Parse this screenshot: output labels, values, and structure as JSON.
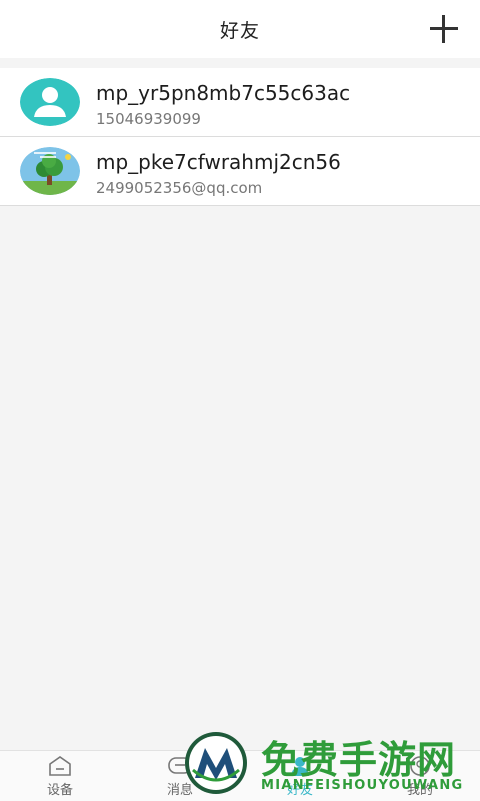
{
  "header": {
    "title": "好友",
    "add_icon": "plus-icon"
  },
  "friends": [
    {
      "name": "mp_yr5pn8mb7c55c63ac",
      "subtitle": "15046939099",
      "avatar": "default-user-avatar"
    },
    {
      "name": "mp_pke7cfwrahmj2cn56",
      "subtitle": "2499052356@qq.com",
      "avatar": "tree-landscape-avatar"
    }
  ],
  "tabbar": {
    "tabs": [
      {
        "label": "设备",
        "icon": "home-device-icon",
        "active": false
      },
      {
        "label": "消息",
        "icon": "message-icon",
        "active": false
      },
      {
        "label": "好友",
        "icon": "friends-icon",
        "active": true
      },
      {
        "label": "我的",
        "icon": "profile-icon",
        "active": false
      }
    ]
  },
  "watermark": {
    "cn_text": "免费手游网",
    "en_text": "MIANFEISHOUYOUWANG"
  },
  "colors": {
    "accent": "#3ab7c8",
    "avatar_teal": "#33c4c0",
    "watermark_green": "#2f9c3a"
  }
}
